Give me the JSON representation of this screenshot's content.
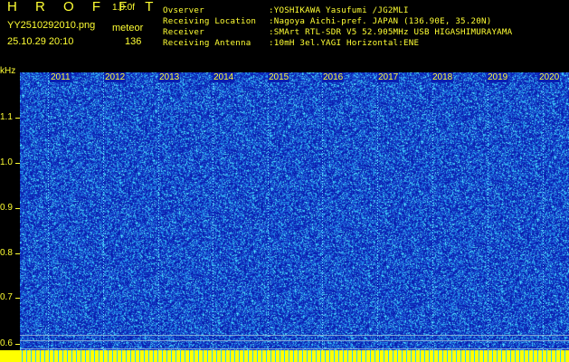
{
  "header": {
    "app_title": "H R O F F T",
    "version": "1.0.0f",
    "filename": "YY2510292010.png",
    "mode": "meteor",
    "datetime": "25.10.29 20:10",
    "count": "136"
  },
  "info": [
    {
      "label": "Ovserver",
      "value": ":YOSHIKAWA Yasufumi /JG2MLI"
    },
    {
      "label": "Receiving Location",
      "value": ":Nagoya Aichi-pref. JAPAN (136.90E, 35.20N)"
    },
    {
      "label": "Receiver",
      "value": ":SMArt RTL-SDR V5 52.905MHz USB HIGASHIMURAYAMA"
    },
    {
      "label": "Receiving Antenna",
      "value": ":10mH 3el.YAGI Horizontal:ENE"
    }
  ],
  "axis": {
    "unit": "kHz",
    "yticks": [
      "1.1",
      "1.0",
      "0.9",
      "0.8",
      "0.7",
      "0.6"
    ],
    "x_labels": [
      "2011",
      "2012",
      "2013",
      "2014",
      "2015",
      "2016",
      "2017",
      "2018",
      "2019",
      "2020"
    ]
  },
  "colors": {
    "text": "#ffff33",
    "background": "#000000",
    "spectrogram_base": "#0a1fb0",
    "noise_bright": "#33ddff",
    "noise_mid": "#1e5ad8",
    "band": "#ffff00"
  }
}
